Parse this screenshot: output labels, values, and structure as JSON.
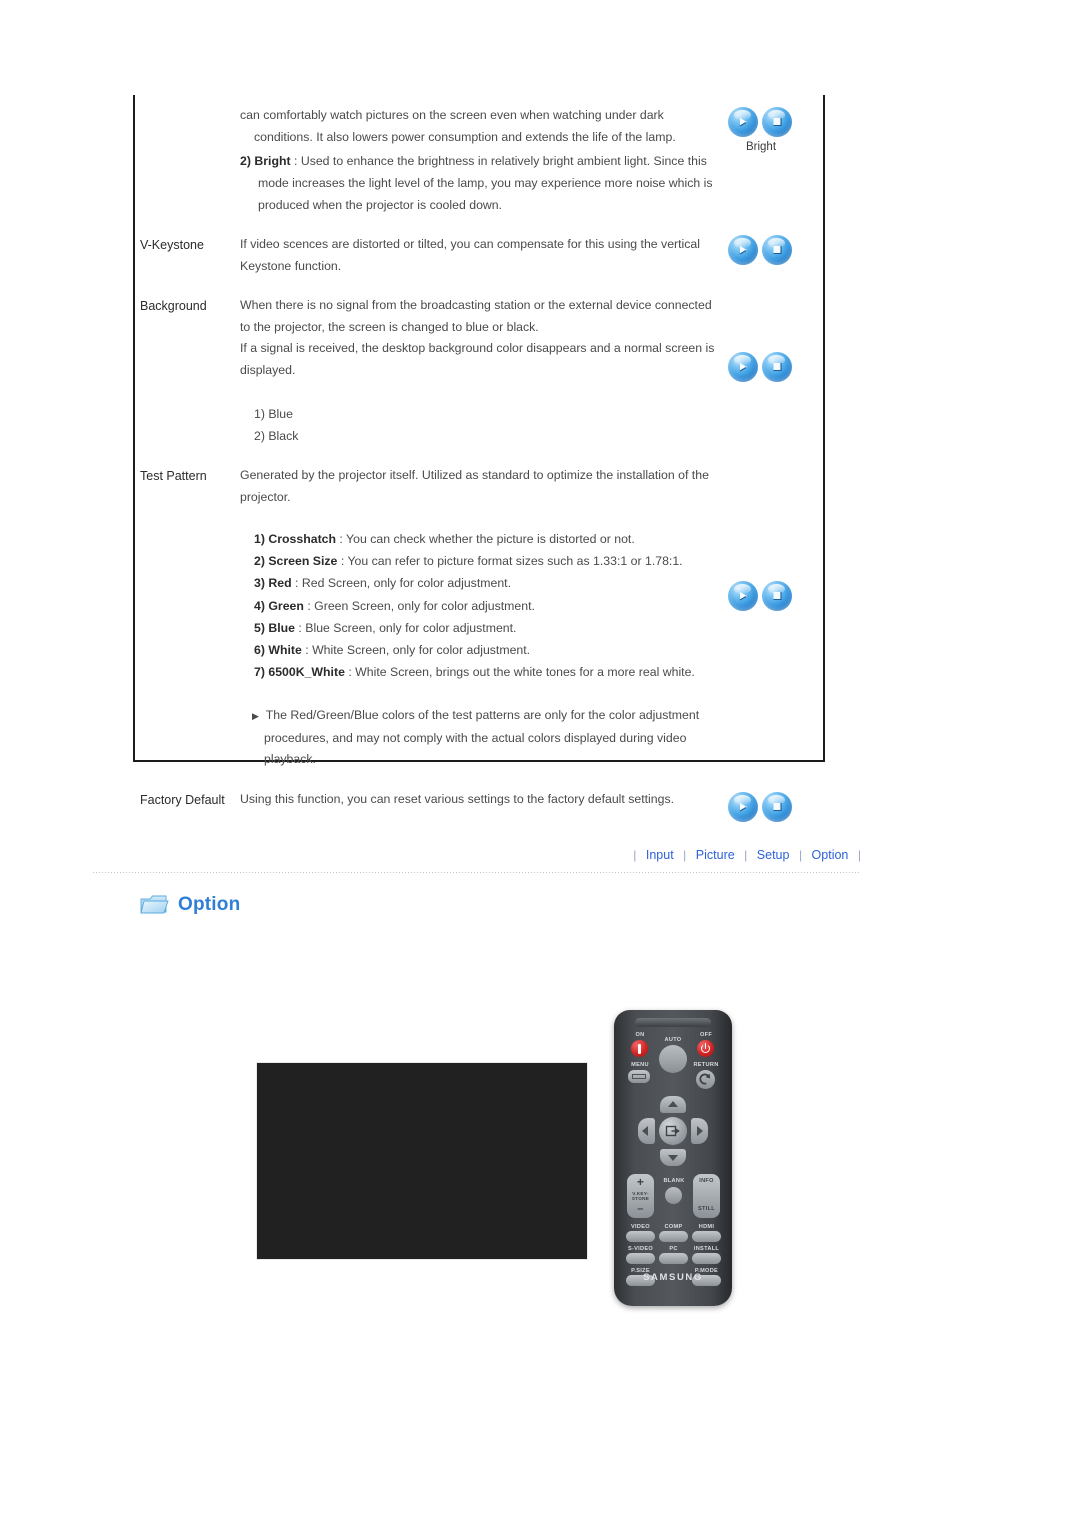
{
  "spec_table": {
    "rows": [
      {
        "label": "",
        "paragraphs": [
          "can comfortably watch pictures on the screen even when watching under dark conditions. It also lowers power consumption and extends the life of the lamp."
        ],
        "numbered": [
          {
            "num": "2)",
            "term": "Bright",
            "sep": " : ",
            "text": "Used to enhance the brightness in relatively bright ambient light. Since this mode increases the light level of the lamp, you may experience more noise which is produced when the projector is cooled down."
          }
        ],
        "icon_caption": "Bright"
      },
      {
        "label": "V-Keystone",
        "paragraphs": [
          "If video scences are distorted or tilted, you can compensate for this using the vertical Keystone function."
        ]
      },
      {
        "label": "Background",
        "paragraphs": [
          "When there is no signal from the broadcasting station or the external device connected to the projector, the screen is changed to blue or black.",
          "If a signal is received, the desktop background color disappears and a normal screen is displayed."
        ],
        "numbered": [
          {
            "num": "1)",
            "term": "",
            "sep": "",
            "text": "Blue"
          },
          {
            "num": "2)",
            "term": "",
            "sep": "",
            "text": "Black"
          }
        ]
      },
      {
        "label": "Test Pattern",
        "paragraphs": [
          "Generated by the projector itself. Utilized as standard to optimize the installation of the projector."
        ],
        "numbered": [
          {
            "num": "1)",
            "term": "Crosshatch",
            "sep": " : ",
            "text": "You can check whether the picture is distorted or not."
          },
          {
            "num": "2)",
            "term": "Screen Size",
            "sep": " : ",
            "text": "You can refer to picture format sizes such as 1.33:1 or 1.78:1."
          },
          {
            "num": "3)",
            "term": "Red",
            "sep": " : ",
            "text": "Red Screen, only for color adjustment."
          },
          {
            "num": "4)",
            "term": "Green",
            "sep": " : ",
            "text": "Green Screen, only for color adjustment."
          },
          {
            "num": "5)",
            "term": "Blue",
            "sep": " : ",
            "text": "Blue Screen, only for color adjustment."
          },
          {
            "num": "6)",
            "term": "White",
            "sep": " : ",
            "text": "White Screen, only for color adjustment."
          },
          {
            "num": "7)",
            "term": "6500K_White",
            "sep": " : ",
            "text": "White Screen, brings out the white tones for a more real white."
          }
        ],
        "note": "The Red/Green/Blue colors of the test patterns are only for the color adjustment procedures, and may not comply with the actual colors displayed during video playback.",
        "note_marker": "▶"
      },
      {
        "label": "Factory Default",
        "paragraphs": [
          "Using this function, you can reset various settings to the factory default settings."
        ]
      }
    ]
  },
  "nav": {
    "separator": "|",
    "items": [
      {
        "label": "Input"
      },
      {
        "label": "Picture"
      },
      {
        "label": "Setup"
      },
      {
        "label": "Option"
      }
    ]
  },
  "section": {
    "title": "Option",
    "icon": "folder-icon"
  },
  "remote": {
    "brand": "SAMSUNG",
    "top_labels": {
      "on": "ON",
      "auto": "AUTO",
      "off": "OFF",
      "menu": "MENU",
      "return": "RETURN"
    },
    "mid_labels": {
      "keystone_plus": "+",
      "keystone": "V.KEY-\nSTONE",
      "keystone_minus": "–",
      "blank": "BLANK",
      "info": "INFO",
      "still": "STILL"
    },
    "source_rows": [
      [
        "VIDEO",
        "COMP",
        "HDMI"
      ],
      [
        "S-VIDEO",
        "PC",
        "INSTALL"
      ],
      [
        "P.SIZE",
        "",
        "P.MODE"
      ]
    ]
  },
  "colors": {
    "link": "#2d62d8",
    "title": "#2f7fd6",
    "icon_blue": "#3f9fe3",
    "border": "#1b1b1b",
    "screen_black": "#212121",
    "remote_body": "#4a4e52",
    "power_red": "#d42323"
  }
}
